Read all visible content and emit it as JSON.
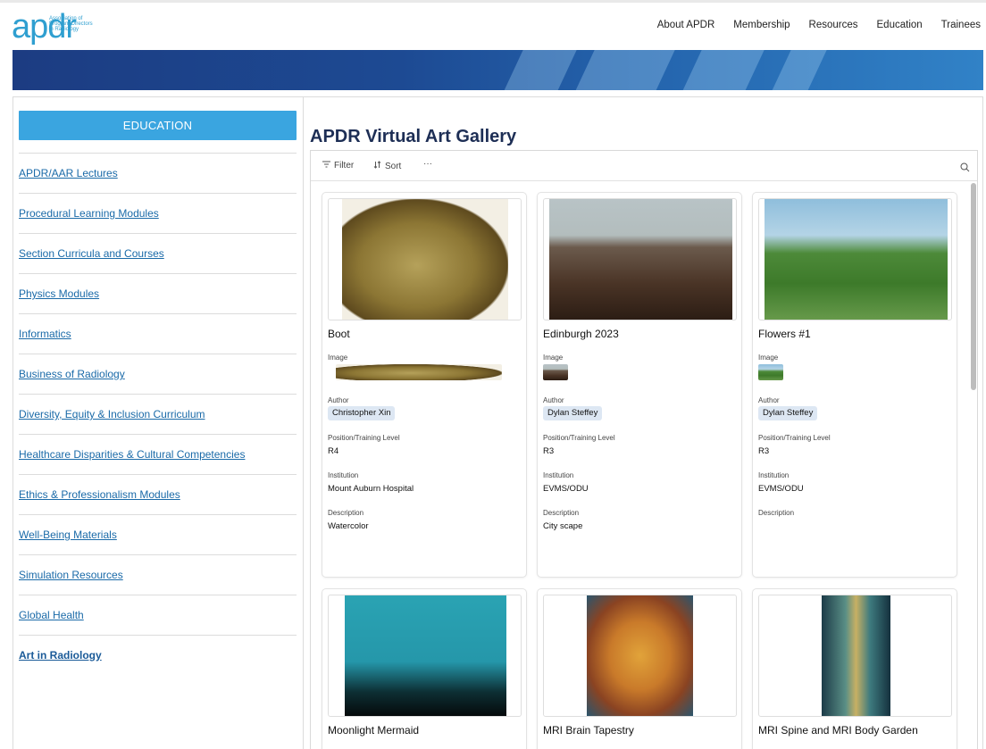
{
  "header": {
    "logo_mark": "apdr",
    "logo_sub": [
      "Association of",
      "Program Directors",
      "in Radiology"
    ],
    "nav": [
      "About APDR",
      "Membership",
      "Resources",
      "Education",
      "Trainees"
    ]
  },
  "sidebar": {
    "section_button": "EDUCATION",
    "items": [
      {
        "label": "APDR/AAR Lectures"
      },
      {
        "label": "Procedural Learning Modules"
      },
      {
        "label": "Section Curricula and Courses"
      },
      {
        "label": "Physics Modules"
      },
      {
        "label": "Informatics"
      },
      {
        "label": "Business of Radiology"
      },
      {
        "label": "Diversity, Equity & Inclusion Curriculum"
      },
      {
        "label": "Healthcare Disparities & Cultural Competencies"
      },
      {
        "label": "Ethics & Professionalism Modules"
      },
      {
        "label": "Well-Being Materials"
      },
      {
        "label": "Simulation Resources"
      },
      {
        "label": "Global Health"
      },
      {
        "label": "Art in Radiology",
        "active": true
      }
    ]
  },
  "main": {
    "title": "APDR Virtual Art Gallery",
    "toolbar": {
      "filter_label": "Filter",
      "sort_label": "Sort",
      "more_label": "···",
      "search_icon": "search-icon"
    },
    "field_labels": {
      "image": "Image",
      "author": "Author",
      "position": "Position/Training Level",
      "institution": "Institution",
      "description": "Description"
    },
    "cards": [
      {
        "title": "Boot",
        "author": "Christopher Xin",
        "position": "R4",
        "institution": "Mount Auburn Hospital",
        "description": "Watercolor"
      },
      {
        "title": "Edinburgh 2023",
        "author": "Dylan Steffey",
        "position": "R3",
        "institution": "EVMS/ODU",
        "description": "City scape"
      },
      {
        "title": "Flowers #1",
        "author": "Dylan Steffey",
        "position": "R3",
        "institution": "EVMS/ODU",
        "description": ""
      },
      {
        "title": "Moonlight Mermaid"
      },
      {
        "title": "MRI Brain Tapestry"
      },
      {
        "title": "MRI Spine and MRI Body Garden"
      }
    ]
  },
  "colors": {
    "accent": "#3aa5e0",
    "link": "#1a6aa8",
    "title": "#1d2e55",
    "chip": "#dde7f3"
  }
}
